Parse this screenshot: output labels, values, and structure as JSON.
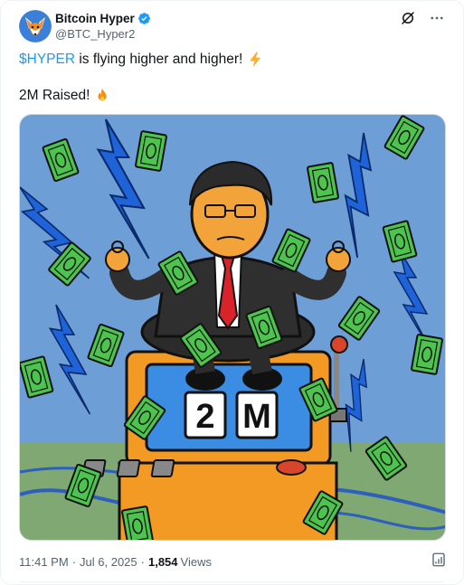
{
  "author": {
    "display_name": "Bitcoin Hyper",
    "handle": "@BTC_Hyper2",
    "verified": true,
    "verified_color": "#1d9bf0",
    "avatar_icon": "fox-avatar-icon"
  },
  "header": {
    "icons": [
      "grok-icon",
      "more-icon"
    ]
  },
  "tweet": {
    "cashtag": "$HYPER",
    "text_line1_rest": " is flying higher and higher!",
    "line1_emoji": "lightning-emoji",
    "text_line2": "2M Raised!",
    "line2_emoji": "fire-emoji"
  },
  "media": {
    "slot_left": "2",
    "slot_right": "M",
    "description_icons": [
      "money-bill-icon",
      "lightning-bolt-icon",
      "slot-machine-icon"
    ]
  },
  "meta": {
    "time": "11:41 PM",
    "separator": "·",
    "date": "Jul 6, 2025",
    "views_count": "1,854",
    "views_label": "Views"
  },
  "colors": {
    "accent": "#1d9bf0",
    "text_primary": "#0f1419",
    "text_secondary": "#536471",
    "sky": "#6d9ed6",
    "grass": "#7fa872",
    "slot_orange": "#f39a24",
    "slot_screen": "#3b8de3",
    "bill_green": "#4cc44d",
    "lightning_blue": "#1f63d8"
  }
}
